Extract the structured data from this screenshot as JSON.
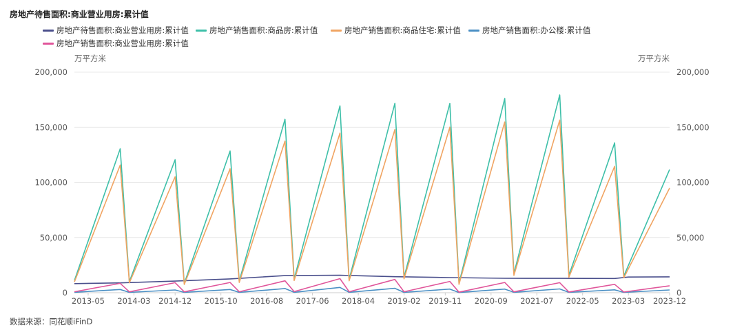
{
  "source_note": "数据来源：同花顺iFinD",
  "colors": {
    "grid": "#e9e9e9",
    "axis": "#cccccc"
  },
  "chart_data": {
    "type": "line",
    "title": "房地产待售面积:商业营业用房:累计值",
    "y_unit_left": "万平方米",
    "y_unit_right": "万平方米",
    "ylim": [
      0,
      200000
    ],
    "y_ticks": [
      0,
      50000,
      100000,
      150000,
      200000
    ],
    "y_tick_labels": [
      "0",
      "50,000",
      "100,000",
      "150,000",
      "200,000"
    ],
    "x_tick_labels": [
      "2013-05",
      "2014-03",
      "2014-12",
      "2015-10",
      "2016-08",
      "2017-06",
      "2018-04",
      "2019-02",
      "2019-11",
      "2020-09",
      "2021-07",
      "2022-05",
      "2023-03",
      "2023-12"
    ],
    "grid": true,
    "legend_position": "top",
    "series": [
      {
        "name": "房地产待售面积:商业营业用房:累计值",
        "color": "#4a4f8c",
        "points": [
          [
            "2013-02",
            8200
          ],
          [
            "2013-12",
            8900
          ],
          [
            "2014-12",
            10500
          ],
          [
            "2015-12",
            12500
          ],
          [
            "2016-12",
            15500
          ],
          [
            "2017-12",
            15800
          ],
          [
            "2018-12",
            14500
          ],
          [
            "2019-12",
            13700
          ],
          [
            "2020-12",
            13100
          ],
          [
            "2021-12",
            13000
          ],
          [
            "2022-12",
            12900
          ],
          [
            "2023-03",
            14200
          ],
          [
            "2023-12",
            14400
          ]
        ]
      },
      {
        "name": "房地产销售面积:商品房:累计值",
        "color": "#3dbfa8",
        "points": [
          [
            "2013-02",
            11000
          ],
          [
            "2013-12",
            130500
          ],
          [
            "2014-02",
            10000
          ],
          [
            "2014-12",
            120600
          ],
          [
            "2015-02",
            8400
          ],
          [
            "2015-12",
            128500
          ],
          [
            "2016-02",
            10600
          ],
          [
            "2016-12",
            157300
          ],
          [
            "2017-02",
            12500
          ],
          [
            "2017-12",
            169400
          ],
          [
            "2018-02",
            12000
          ],
          [
            "2018-12",
            171700
          ],
          [
            "2019-02",
            14100
          ],
          [
            "2019-12",
            171600
          ],
          [
            "2020-02",
            8500
          ],
          [
            "2020-12",
            176100
          ],
          [
            "2021-02",
            17400
          ],
          [
            "2021-12",
            179400
          ],
          [
            "2022-02",
            15700
          ],
          [
            "2022-12",
            135800
          ],
          [
            "2023-02",
            15100
          ],
          [
            "2023-12",
            111700
          ]
        ]
      },
      {
        "name": "房地产销售面积:商品住宅:累计值",
        "color": "#f0a462",
        "points": [
          [
            "2013-02",
            9800
          ],
          [
            "2013-12",
            115700
          ],
          [
            "2014-02",
            9000
          ],
          [
            "2014-12",
            105200
          ],
          [
            "2015-02",
            7500
          ],
          [
            "2015-12",
            112400
          ],
          [
            "2016-02",
            9300
          ],
          [
            "2016-12",
            137500
          ],
          [
            "2017-02",
            11000
          ],
          [
            "2017-12",
            144800
          ],
          [
            "2018-02",
            10800
          ],
          [
            "2018-12",
            147900
          ],
          [
            "2019-02",
            12600
          ],
          [
            "2019-12",
            150100
          ],
          [
            "2020-02",
            7600
          ],
          [
            "2020-12",
            154900
          ],
          [
            "2021-02",
            15700
          ],
          [
            "2021-12",
            156500
          ],
          [
            "2022-02",
            14000
          ],
          [
            "2022-12",
            114600
          ],
          [
            "2023-02",
            13500
          ],
          [
            "2023-12",
            94800
          ]
        ]
      },
      {
        "name": "房地产销售面积:办公楼:累计值",
        "color": "#4a8fc4",
        "points": [
          [
            "2013-02",
            400
          ],
          [
            "2013-12",
            2900
          ],
          [
            "2014-02",
            300
          ],
          [
            "2014-12",
            2500
          ],
          [
            "2015-02",
            300
          ],
          [
            "2015-12",
            2900
          ],
          [
            "2016-02",
            300
          ],
          [
            "2016-12",
            3800
          ],
          [
            "2017-02",
            400
          ],
          [
            "2017-12",
            4800
          ],
          [
            "2018-02",
            400
          ],
          [
            "2018-12",
            4000
          ],
          [
            "2019-02",
            300
          ],
          [
            "2019-12",
            3300
          ],
          [
            "2020-02",
            200
          ],
          [
            "2020-12",
            3300
          ],
          [
            "2021-02",
            400
          ],
          [
            "2021-12",
            3400
          ],
          [
            "2022-02",
            300
          ],
          [
            "2022-12",
            2600
          ],
          [
            "2023-02",
            300
          ],
          [
            "2023-12",
            2500
          ]
        ]
      },
      {
        "name": "房地产销售面积:商业营业用房:累计值",
        "color": "#e0559a",
        "points": [
          [
            "2013-02",
            900
          ],
          [
            "2013-12",
            8500
          ],
          [
            "2014-02",
            800
          ],
          [
            "2014-12",
            9100
          ],
          [
            "2015-02",
            800
          ],
          [
            "2015-12",
            9300
          ],
          [
            "2016-02",
            900
          ],
          [
            "2016-12",
            10800
          ],
          [
            "2017-02",
            1000
          ],
          [
            "2017-12",
            12800
          ],
          [
            "2018-02",
            900
          ],
          [
            "2018-12",
            12000
          ],
          [
            "2019-02",
            900
          ],
          [
            "2019-12",
            10200
          ],
          [
            "2020-02",
            500
          ],
          [
            "2020-12",
            9300
          ],
          [
            "2021-02",
            800
          ],
          [
            "2021-12",
            9100
          ],
          [
            "2022-02",
            700
          ],
          [
            "2022-12",
            7600
          ],
          [
            "2023-02",
            600
          ],
          [
            "2023-12",
            6300
          ]
        ]
      }
    ]
  }
}
